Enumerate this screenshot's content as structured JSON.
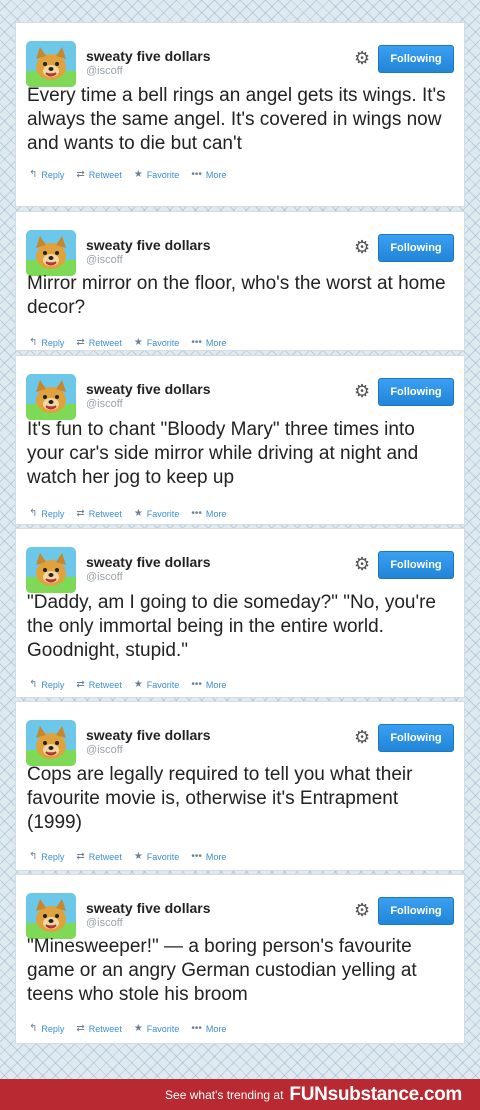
{
  "tweets": [
    {
      "name": "sweaty five dollars",
      "handle": "@iscoff",
      "follow_label": "Following",
      "text": "Every time a bell rings an angel gets its wings. It's always the same angel. It's covered in wings now and wants to die but can't",
      "actions": [
        "Reply",
        "Retweet",
        "Favorite",
        "More"
      ]
    },
    {
      "name": "sweaty five dollars",
      "handle": "@iscoff",
      "follow_label": "Following",
      "text": "Mirror mirror on the floor, who's the worst at home decor?",
      "actions": [
        "Reply",
        "Retweet",
        "Favorite",
        "More"
      ]
    },
    {
      "name": "sweaty five dollars",
      "handle": "@iscoff",
      "follow_label": "Following",
      "text": "It's fun to chant \"Bloody Mary\" three times into your car's side mirror while driving at night and watch her jog to keep up",
      "actions": [
        "Reply",
        "Retweet",
        "Favorite",
        "More"
      ]
    },
    {
      "name": "sweaty five dollars",
      "handle": "@iscoff",
      "follow_label": "Following",
      "text": "\"Daddy, am I going to die someday?\" \"No, you're the only immortal being in the entire world. Goodnight, stupid.\"",
      "actions": [
        "Reply",
        "Retweet",
        "Favorite",
        "More"
      ]
    },
    {
      "name": "sweaty five dollars",
      "handle": "@iscoff",
      "follow_label": "Following",
      "text": "Cops are legally required to tell you what their favourite movie is, otherwise it's Entrapment (1999)",
      "actions": [
        "Reply",
        "Retweet",
        "Favorite",
        "More"
      ]
    },
    {
      "name": "sweaty five dollars",
      "handle": "@iscoff",
      "follow_label": "Following",
      "text": "\"Minesweeper!\" — a boring person's favourite game or an angry German custodian yelling at teens who stole his broom",
      "actions": [
        "Reply",
        "Retweet",
        "Favorite",
        "More"
      ]
    }
  ],
  "footer": {
    "prefix": "See what's trending at",
    "brand": "FUNsubstance.com"
  },
  "colors": {
    "follow_button": "#2185d8",
    "action_link": "#3b8fd6",
    "footer_bar": "#b82931"
  }
}
